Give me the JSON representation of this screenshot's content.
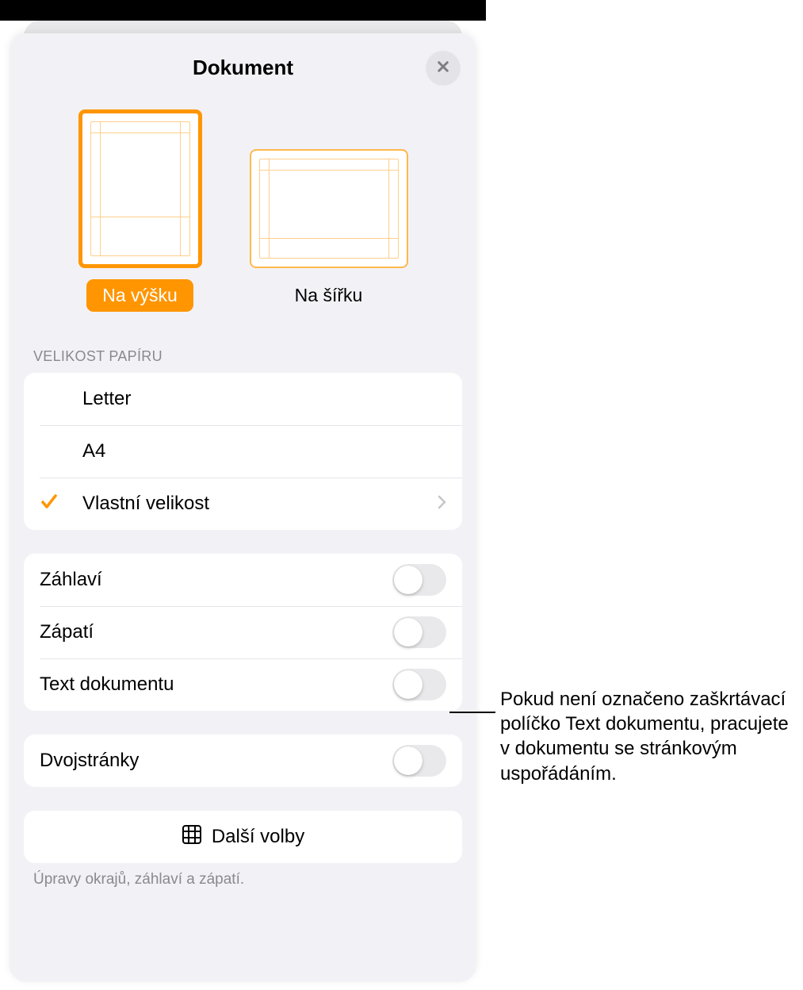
{
  "title": "Dokument",
  "orientation": {
    "portrait_label": "Na výšku",
    "landscape_label": "Na šířku"
  },
  "paper_size": {
    "header": "Velikost papíru",
    "options": {
      "letter": "Letter",
      "a4": "A4",
      "custom": "Vlastní velikost"
    }
  },
  "toggles": {
    "header": "Záhlaví",
    "footer": "Zápatí",
    "body": "Text dokumentu",
    "spreads": "Dvojstránky"
  },
  "more_options": "Další volby",
  "footer_note": "Úpravy okrajů, záhlaví a zápatí.",
  "callout": "Pokud není označeno zaškrtávací políčko Text dokumentu, pracujete v dokumentu se stránkovým uspořádáním."
}
